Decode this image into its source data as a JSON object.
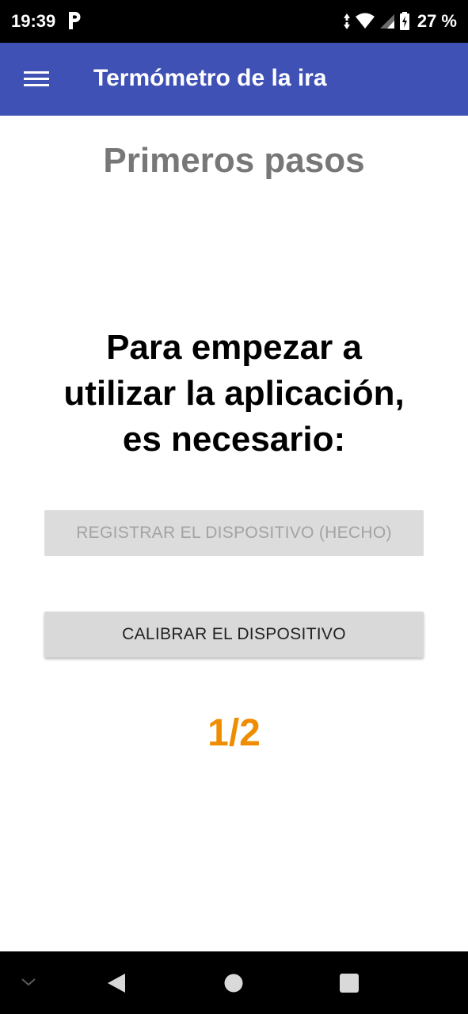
{
  "status_bar": {
    "time": "19:39",
    "battery_percent": "27 %",
    "icons": [
      "parking-icon",
      "data-arrows-icon",
      "wifi-icon",
      "signal-icon",
      "battery-charging-icon"
    ]
  },
  "app_bar": {
    "title": "Termómetro de la ira",
    "menu_icon": "hamburger-menu-icon",
    "color": "#3f51b5"
  },
  "main": {
    "page_title": "Primeros pasos",
    "intro_lines": [
      "Para empezar a",
      "utilizar la aplicación,",
      "es necesario:"
    ],
    "register_button": {
      "label": "REGISTRAR EL DISPOSITIVO (HECHO)",
      "enabled": false
    },
    "calibrate_button": {
      "label": "CALIBRAR EL DISPOSITIVO",
      "enabled": true
    },
    "progress_text": "1/2",
    "progress_color": "#f08c00"
  },
  "nav_bar": {
    "icons": [
      "collapse-chevron-icon",
      "back-icon",
      "home-icon",
      "recents-icon"
    ]
  }
}
